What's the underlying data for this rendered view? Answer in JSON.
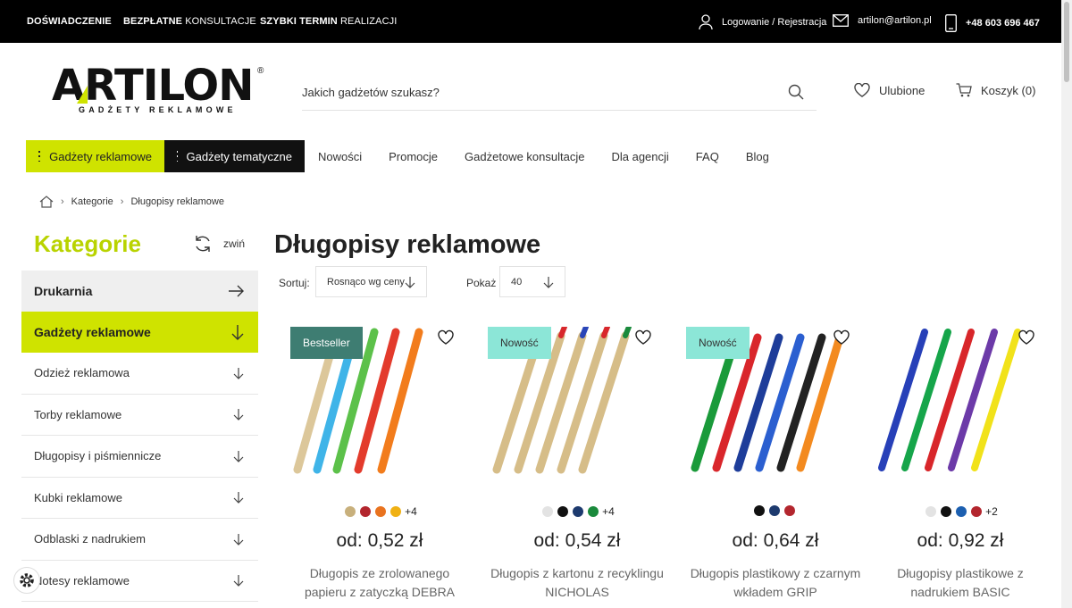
{
  "topbar": {
    "links": [
      {
        "bold": "DOŚWIADCZENIE",
        "light": ""
      },
      {
        "bold": "BEZPŁATNE",
        "light": " KONSULTACJE"
      },
      {
        "bold": "SZYBKI TERMIN",
        "light": " REALIZACJI"
      }
    ],
    "login": "Logowanie / Rejestracja",
    "email": "artilon@artilon.pl",
    "phone": "+48 603 696 467"
  },
  "logo": {
    "word": "ARTILON",
    "reg": "®",
    "tagline": "GADŻETY REKLAMOWE"
  },
  "search": {
    "placeholder": "Jakich gadżetów szukasz?"
  },
  "header": {
    "favorites": "Ulubione",
    "cart": "Koszyk (0)"
  },
  "nav": {
    "cat_lime": "Gadżety reklamowe",
    "cat_dark": "Gadżety tematyczne",
    "items": [
      "Nowości",
      "Promocje",
      "Gadżetowe konsultacje",
      "Dla agencji",
      "FAQ",
      "Blog"
    ]
  },
  "breadcrumb": {
    "items": [
      "Kategorie",
      "Długopisy reklamowe"
    ]
  },
  "sidebar": {
    "title": "Kategorie",
    "collapse": "zwiń",
    "items": [
      "Drukarnia",
      "Gadżety reklamowe",
      "Odzież reklamowa",
      "Torby reklamowe",
      "Długopisy i piśmiennicze",
      "Kubki reklamowe",
      "Odblaski z nadrukiem",
      "Notesy reklamowe"
    ]
  },
  "main": {
    "title": "Długopisy reklamowe",
    "sort_label": "Sortuj:",
    "sort_value": "Rosnąco wg ceny",
    "show_label": "Pokaż",
    "show_value": "40"
  },
  "products": [
    {
      "badge": "Bestseller",
      "swatches": [
        "#c8b07c",
        "#b3262e",
        "#e9731f",
        "#f0b114"
      ],
      "more": "+4",
      "price": "od: 0,52 zł",
      "name": "Długopis ze zrolowanego papieru z zatyczką DEBRA"
    },
    {
      "badge": "Nowość",
      "swatches": [
        "#e3e3e3",
        "#111111",
        "#1d3a6e",
        "#1a8a3c"
      ],
      "more": "+4",
      "price": "od: 0,54 zł",
      "name": "Długopis z kartonu z recyklingu NICHOLAS"
    },
    {
      "badge": "Nowość",
      "swatches": [
        "#111111",
        "#1d3a6e",
        "#b3262e"
      ],
      "more": "",
      "price": "od: 0,64 zł",
      "name": "Długopis plastikowy z czarnym wkładem GRIP"
    },
    {
      "badge": "",
      "swatches": [
        "#e3e3e3",
        "#111111",
        "#1c5fb0",
        "#b3262e"
      ],
      "more": "+2",
      "price": "od: 0,92 zł",
      "name": "Długopisy plastikowe z nadrukiem BASIC"
    }
  ]
}
